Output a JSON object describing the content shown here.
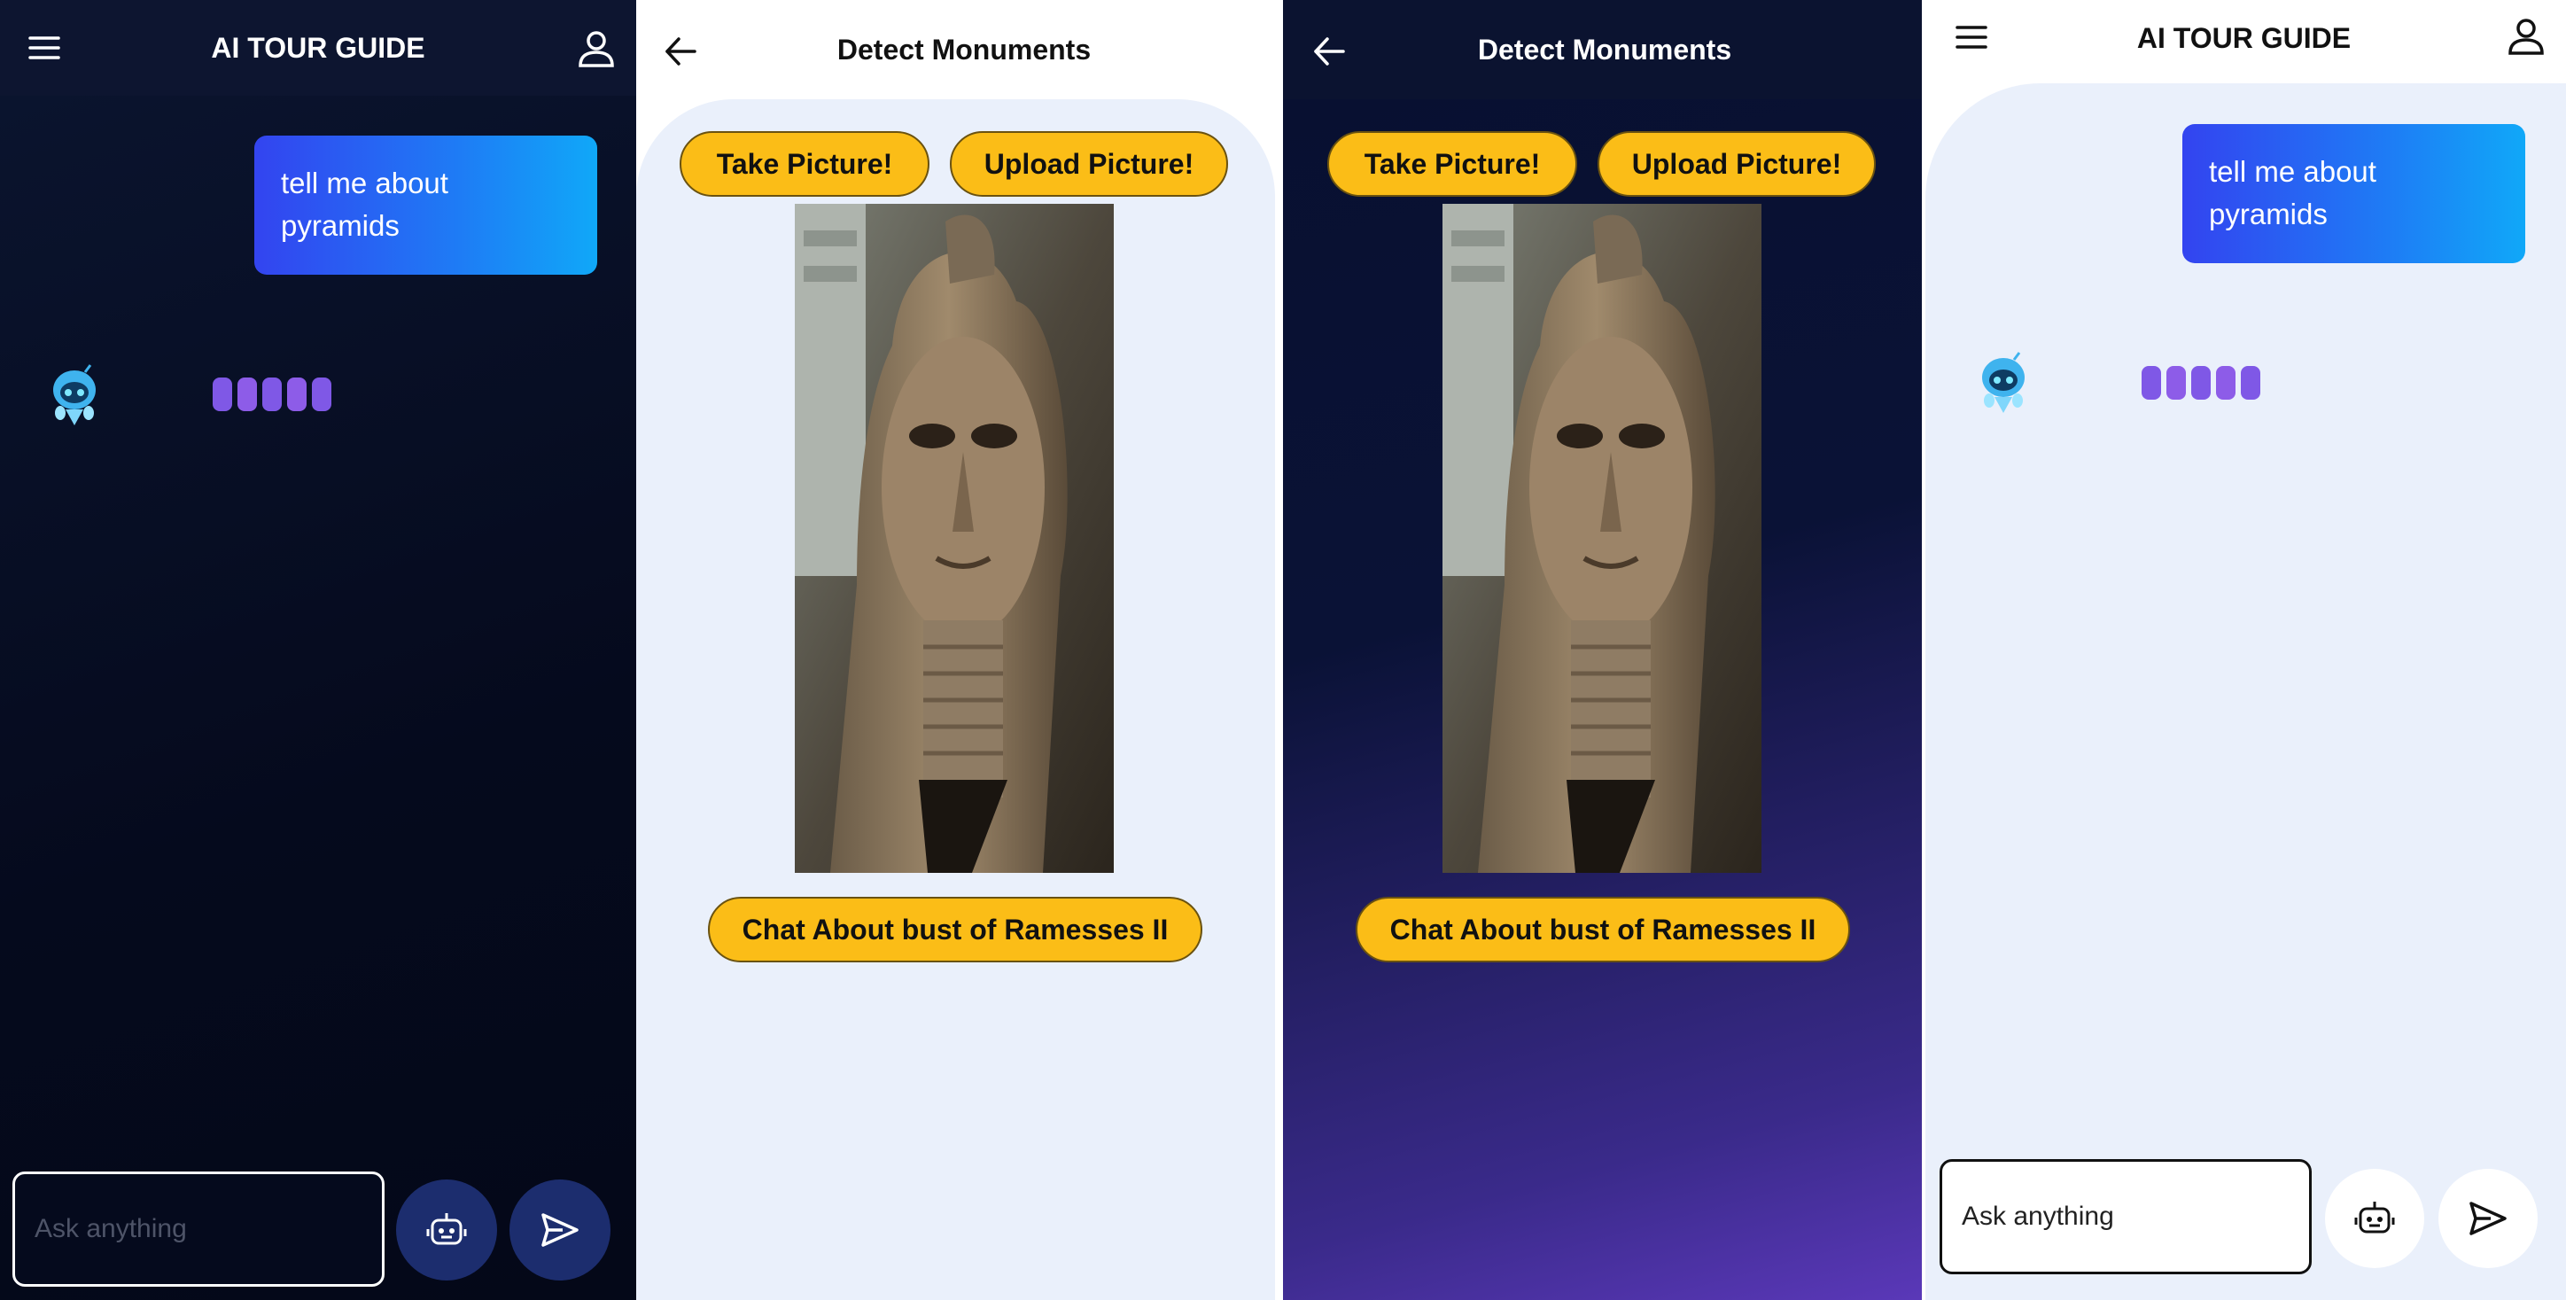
{
  "chat": {
    "title": "AI TOUR GUIDE",
    "user_message": "tell me about pyramids",
    "input_placeholder": "Ask anything",
    "icons": {
      "menu": "menu-icon",
      "profile": "user-icon",
      "assistant_avatar": "robot-avatar-icon",
      "bot_mode": "robot-icon",
      "send": "send-icon"
    }
  },
  "detect": {
    "title": "Detect Monuments",
    "take_picture_label": "Take Picture!",
    "upload_picture_label": "Upload Picture!",
    "chat_about_label": "Chat About bust of Ramesses II",
    "icons": {
      "back": "arrow-left-icon"
    }
  },
  "colors": {
    "accent_yellow": "#fbbd17",
    "bubble_gradient_start": "#3344f0",
    "bubble_gradient_end": "#10a8f8",
    "typing_purple": "#8d5ce8",
    "dark_bg": "#050a1d",
    "light_bg": "#eaf0fb"
  }
}
